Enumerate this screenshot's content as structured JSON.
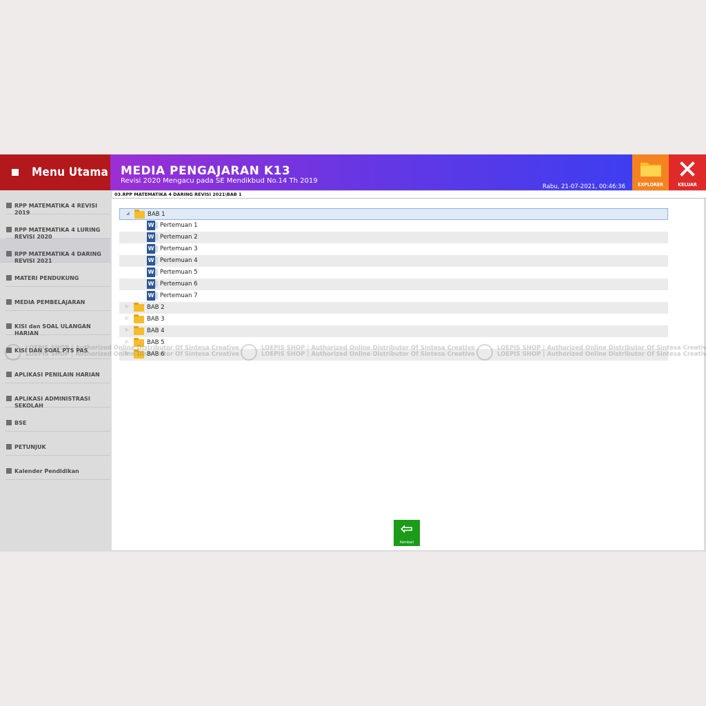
{
  "header": {
    "menu_title": "Menu Utama",
    "app_title": "MEDIA PENGAJARAN K13",
    "subtitle": "Revisi 2020 Mengacu pada SE Mendikbud No.14 Th 2019",
    "datetime": "Rabu, 21-07-2021, 00:46:36",
    "explorer_label": "EXPLORER",
    "keluar_label": "KELUAR"
  },
  "sidebar": {
    "items": [
      {
        "label": "RPP MATEMATIKA 4 REVISI 2019"
      },
      {
        "label": "RPP MATEMATIKA 4 LURING REVISI 2020"
      },
      {
        "label": "RPP MATEMATIKA 4 DARING REVISI 2021"
      },
      {
        "label": "MATERI PENDUKUNG"
      },
      {
        "label": "MEDIA PEMBELAJARAN"
      },
      {
        "label": "KISI dan SOAL ULANGAN HARIAN"
      },
      {
        "label": "KISI DAN SOAL PTS PAS"
      },
      {
        "label": "APLIKASI PENILAIN HARIAN"
      },
      {
        "label": "APLIKASI ADMINISTRASI SEKOLAH"
      },
      {
        "label": "BSE"
      },
      {
        "label": "PETUNJUK"
      },
      {
        "label": "Kalender Pendidikan"
      }
    ]
  },
  "path": "03.RPP MATEMATIKA 4 DARING REVISI 2021\\BAB 1",
  "tree": {
    "bab1": "BAB 1",
    "files": [
      "Pertemuan 1",
      "Pertemuan 2",
      "Pertemuan 3",
      "Pertemuan 4",
      "Pertemuan 5",
      "Pertemuan 6",
      "Pertemuan 7"
    ],
    "folders": [
      "BAB 2",
      "BAB 3",
      "BAB 4",
      "BAB 5",
      "BAB 6"
    ],
    "word_icon_letter": "W"
  },
  "watermark": {
    "text": "LOEPIS SHOP | Authorized Online Distributor Of Sintesa Creative"
  },
  "kembali_label": "Kembali",
  "colors": {
    "menu_red": "#b3181c",
    "explorer_orange": "#f58220",
    "keluar_red": "#e02a2a",
    "kembali_green": "#1a9c1a"
  }
}
